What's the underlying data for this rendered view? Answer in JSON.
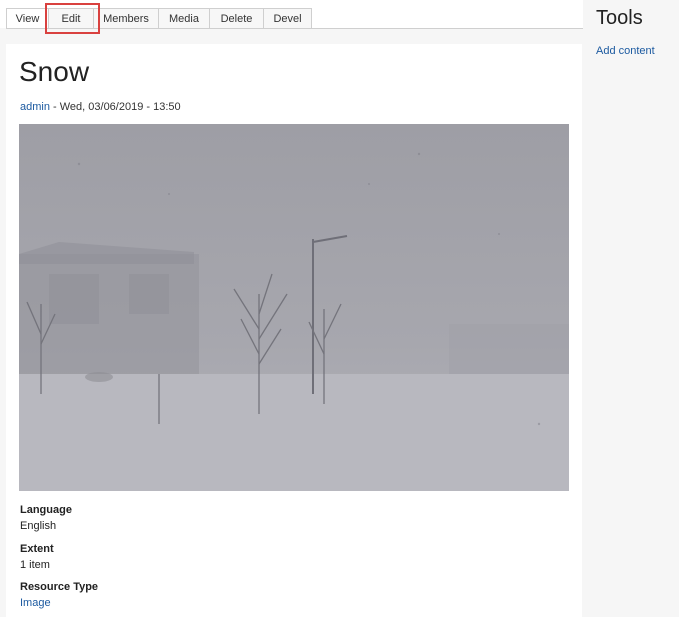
{
  "tabs": [
    {
      "label": "View"
    },
    {
      "label": "Edit"
    },
    {
      "label": "Members"
    },
    {
      "label": "Media"
    },
    {
      "label": "Delete"
    },
    {
      "label": "Devel"
    }
  ],
  "node": {
    "title": "Snow",
    "author": "admin",
    "date": " - Wed, 03/06/2019 - 13:50"
  },
  "fields": {
    "language": {
      "label": "Language",
      "value": "English"
    },
    "extent": {
      "label": "Extent",
      "value": "1 item"
    },
    "resource_type": {
      "label": "Resource Type",
      "value": "Image"
    }
  },
  "sidebar": {
    "title": "Tools",
    "add_content": "Add content"
  },
  "colors": {
    "link": "#1c5aa0",
    "highlight": "#d9413f"
  }
}
